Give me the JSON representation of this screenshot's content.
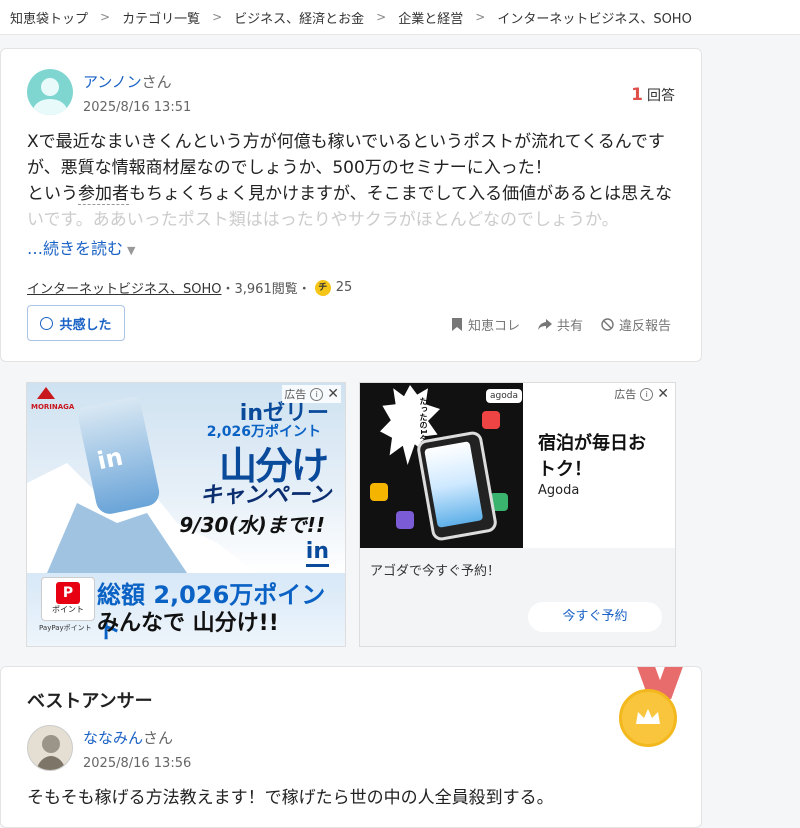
{
  "breadcrumb": [
    {
      "label": "知恵袋トップ"
    },
    {
      "label": "カテゴリ一覧"
    },
    {
      "label": "ビジネス、経済とお金"
    },
    {
      "label": "企業と経営"
    },
    {
      "label": "インターネットビジネス、SOHO"
    }
  ],
  "breadcrumb_separator": ">",
  "question": {
    "user": "アンノン",
    "honorific": "さん",
    "date": "2025/8/16 13:51",
    "answers_count": "1",
    "answers_label": "回答",
    "body_line1": "Xで最近なまいきくんという方が何億も稼いでいるというポストが流れてくるんです",
    "body_line2": "が、悪質な情報商材屋なのでしょうか、500万のセミナーに入った！",
    "body_line3_pre": "という",
    "body_line3_link": "参加者",
    "body_line3_post": "もちょくちょく見かけますが、そこまでして入る価値があるとは思えな",
    "body_line4": "いです。ああいったポスト類ははったりやサクラがほとんどなのでしょうか。",
    "read_more": "…続きを読む",
    "category": "インターネットビジネス、SOHO",
    "views": "・3,961閲覧・",
    "coin_glyph": "チ",
    "coins": "25",
    "empathy_button": "共感した",
    "actions": {
      "save": "知恵コレ",
      "share": "共有",
      "report": "違反報告"
    }
  },
  "ads": {
    "label": "広告",
    "close": "✕",
    "info": "i",
    "left": {
      "maker": "MORINAGA",
      "pouch_text": "in",
      "brand": "inゼリー",
      "points": "2,026万ポイント",
      "headline": "山分け",
      "campaign": "キャンペーン",
      "deadline": "9/30(水)まで!!",
      "logo": "in",
      "paypay_glyph": "P",
      "paypay_label": "ポイント",
      "paypay_sub": "PayPayポイント",
      "total": "総額 2,026万ポイント",
      "everyone": "みんなで 山分け!!"
    },
    "right": {
      "burst_text": "たったの1タップで旅が無限大！",
      "badge": "agoda",
      "title": "宿泊が毎日おトク！",
      "brand": "Agoda",
      "description": "アゴダで今すぐ予約！",
      "button": "今すぐ予約"
    }
  },
  "best_answer": {
    "heading": "ベストアンサー",
    "user": "ななみん",
    "honorific": "さん",
    "date": "2025/8/16 13:56",
    "body": "そもそも稼げる方法教えます！で稼げたら世の中の人全員殺到する。"
  },
  "colors": {
    "link": "#1a62c5",
    "answer_count": "#e0504b",
    "medal": "#f8c53c",
    "ribbon": "#e86c6c"
  }
}
